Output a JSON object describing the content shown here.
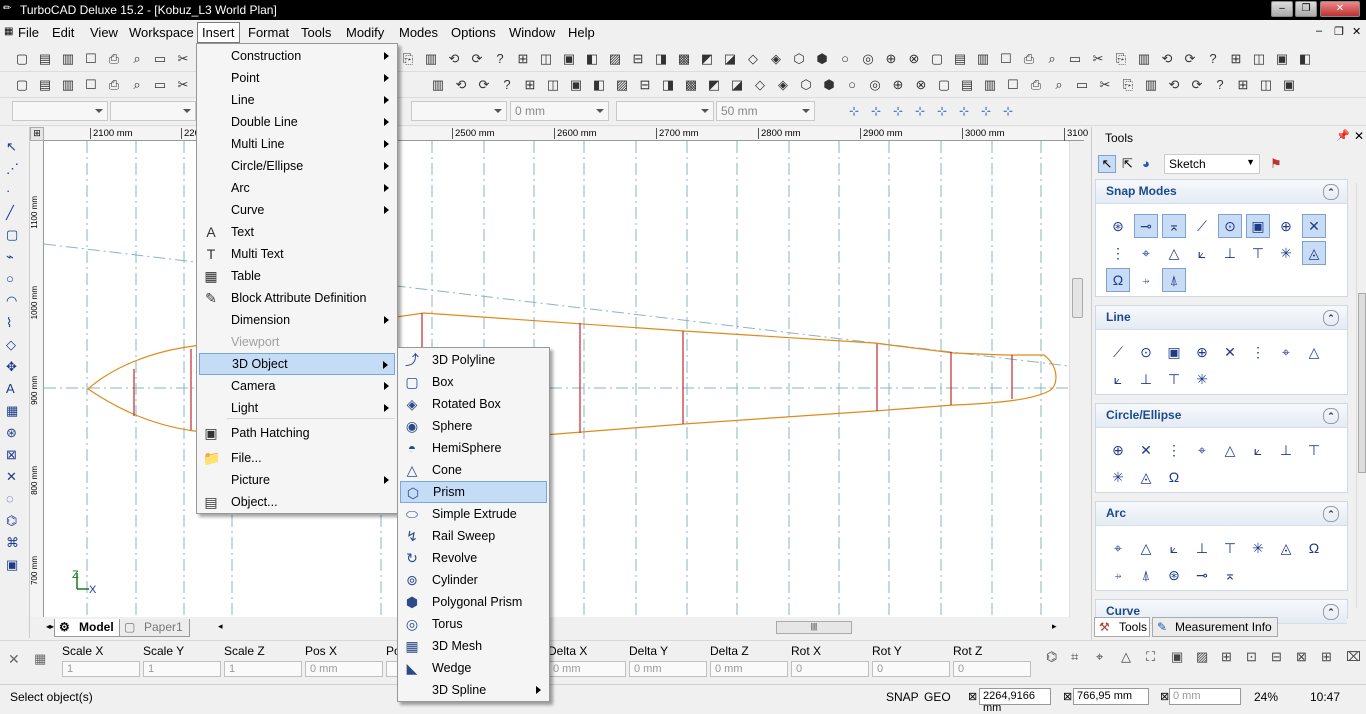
{
  "window": {
    "title": "TurboCAD Deluxe 15.2 - [Kobuz_L3 World Plan]",
    "app_icon": "turbocad-icon"
  },
  "menubar": [
    "File",
    "Edit",
    "View",
    "Workspace",
    "Insert",
    "Format",
    "Tools",
    "Modify",
    "Modes",
    "Options",
    "Window",
    "Help"
  ],
  "toolbar": {
    "combos": [
      "",
      "",
      "0 mm",
      "50 mm"
    ]
  },
  "ruler": {
    "ticks": [
      "2100 mm",
      "220",
      "2500 mm",
      "2600 mm",
      "2700 mm",
      "2800 mm",
      "2900 mm",
      "3000 mm",
      "3100 mm"
    ],
    "vticks": [
      "1100 mm",
      "1000 mm",
      "900 mm",
      "800 mm",
      "700 mm"
    ]
  },
  "insert_menu": {
    "items": [
      {
        "label": "Construction",
        "sub": true
      },
      {
        "label": "Point",
        "sub": true
      },
      {
        "label": "Line",
        "sub": true
      },
      {
        "label": "Double Line",
        "sub": true
      },
      {
        "label": "Multi Line",
        "sub": true
      },
      {
        "label": "Circle/Ellipse",
        "sub": true
      },
      {
        "label": "Arc",
        "sub": true
      },
      {
        "label": "Curve",
        "sub": true
      },
      {
        "label": "Text",
        "icon": "A"
      },
      {
        "label": "Multi Text",
        "icon": "T"
      },
      {
        "label": "Table",
        "icon": "▦"
      },
      {
        "label": "Block Attribute Definition",
        "icon": "✎"
      },
      {
        "label": "Dimension",
        "sub": true
      },
      {
        "label": "Viewport",
        "disabled": true
      },
      {
        "label": "3D Object",
        "sub": true,
        "highlighted": true
      },
      {
        "label": "Camera",
        "sub": true
      },
      {
        "label": "Light",
        "sub": true
      },
      {
        "label": "Path Hatching",
        "icon": "▣"
      },
      {
        "label": "File...",
        "icon": "📁"
      },
      {
        "label": "Picture",
        "sub": true
      },
      {
        "label": "Object...",
        "icon": "▤"
      }
    ]
  },
  "object3d_menu": {
    "items": [
      {
        "label": "3D Polyline",
        "icon": "⤴"
      },
      {
        "label": "Box",
        "icon": "▢"
      },
      {
        "label": "Rotated Box",
        "icon": "◈"
      },
      {
        "label": "Sphere",
        "icon": "◉"
      },
      {
        "label": "HemiSphere",
        "icon": "◓"
      },
      {
        "label": "Cone",
        "icon": "△"
      },
      {
        "label": "Prism",
        "icon": "⬡",
        "highlighted": true
      },
      {
        "label": "Simple Extrude",
        "icon": "⬭"
      },
      {
        "label": "Rail Sweep",
        "icon": "↯"
      },
      {
        "label": "Revolve",
        "icon": "↻"
      },
      {
        "label": "Cylinder",
        "icon": "⊚"
      },
      {
        "label": "Polygonal Prism",
        "icon": "⬢"
      },
      {
        "label": "Torus",
        "icon": "◎"
      },
      {
        "label": "3D Mesh",
        "icon": "▦"
      },
      {
        "label": "Wedge",
        "icon": "◣"
      },
      {
        "label": "3D Spline",
        "icon": "",
        "sub": true
      }
    ]
  },
  "tabs": {
    "model": "Model",
    "paper": "Paper1"
  },
  "inspector": {
    "fields": [
      {
        "label": "Scale X",
        "value": "1"
      },
      {
        "label": "Scale Y",
        "value": "1"
      },
      {
        "label": "Scale Z",
        "value": "1"
      },
      {
        "label": "Pos X",
        "value": "0 mm"
      },
      {
        "label": "Po",
        "value": ""
      },
      {
        "label": "Delta X",
        "value": "0 mm"
      },
      {
        "label": "Delta Y",
        "value": "0 mm"
      },
      {
        "label": "Delta Z",
        "value": "0 mm"
      },
      {
        "label": "Rot X",
        "value": "0"
      },
      {
        "label": "Rot Y",
        "value": "0"
      },
      {
        "label": "Rot Z",
        "value": "0"
      }
    ]
  },
  "status": {
    "text": "Select object(s)",
    "snap": "SNAP",
    "geo": "GEO",
    "x": "2264,9166 mm",
    "y": "766,95 mm",
    "z": "0 mm",
    "zoom": "24%",
    "time": "10:47"
  },
  "tools_panel": {
    "title": "Tools",
    "mode": "Sketch",
    "sections": [
      "Snap Modes",
      "Line",
      "Circle/Ellipse",
      "Arc",
      "Curve"
    ],
    "bottom_tabs": [
      "Tools",
      "Measurement Info"
    ]
  },
  "colors": {
    "profile": "#e08a1a",
    "rib": "#c0282d",
    "axis": "#8ab4c4",
    "highlight": "#c5dcf6"
  }
}
